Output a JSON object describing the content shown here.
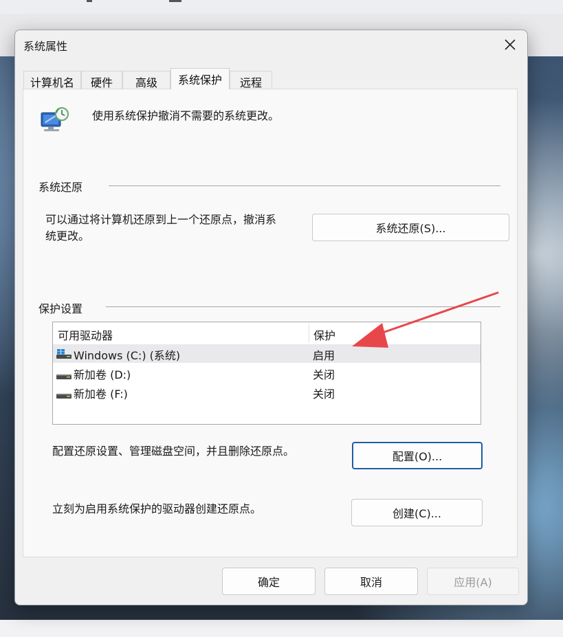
{
  "dialog": {
    "title": "系统属性",
    "tabs": [
      {
        "label": "计算机名"
      },
      {
        "label": "硬件"
      },
      {
        "label": "高级"
      },
      {
        "label": "系统保护"
      },
      {
        "label": "远程"
      }
    ],
    "intro_text": "使用系统保护撤消不需要的系统更改。",
    "system_restore": {
      "group_label": "系统还原",
      "description_line1": "可以通过将计算机还原到上一个还原点，撤消系",
      "description_line2": "统更改。",
      "button_label": "系统还原(S)..."
    },
    "protection": {
      "group_label": "保护设置",
      "columns": {
        "drive": "可用驱动器",
        "protection": "保护"
      },
      "rows": [
        {
          "drive": "Windows (C:) (系统)",
          "status": "启用"
        },
        {
          "drive": "新加卷 (D:)",
          "status": "关闭"
        },
        {
          "drive": "新加卷 (F:)",
          "status": "关闭"
        }
      ],
      "configure_text": "配置还原设置、管理磁盘空间，并且删除还原点。",
      "configure_button": "配置(O)...",
      "create_text": "立刻为启用系统保护的驱动器创建还原点。",
      "create_button": "创建(C)..."
    },
    "footer": {
      "ok": "确定",
      "cancel": "取消",
      "apply": "应用(A)"
    }
  },
  "colors": {
    "accent_border": "#1f5aa6",
    "annotation_arrow": "#e8474a",
    "selected_row": "#e9e9ec"
  }
}
